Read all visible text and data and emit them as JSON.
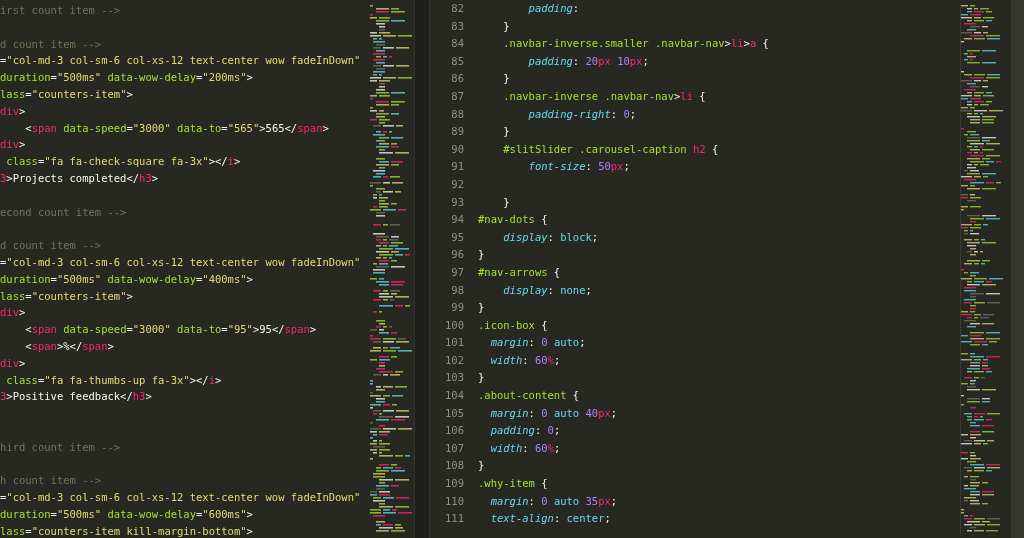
{
  "left_editor": {
    "lines": [
      {
        "kind": "code",
        "tokens": [
          {
            "kind": "comment",
            "text": "irst count item -->"
          }
        ]
      },
      {
        "kind": "blank"
      },
      {
        "kind": "code",
        "tokens": [
          {
            "kind": "comment",
            "text": "d count item -->"
          }
        ]
      },
      {
        "kind": "code",
        "tokens": [
          {
            "kind": "plain",
            "text": "="
          },
          {
            "kind": "string",
            "text": "\"col-md-3 col-sm-6 col-xs-12 text-center wow fadeInDown\""
          }
        ]
      },
      {
        "kind": "code",
        "tokens": [
          {
            "kind": "attr",
            "text": "duration"
          },
          {
            "kind": "plain",
            "text": "="
          },
          {
            "kind": "string",
            "text": "\"500ms\""
          },
          {
            "kind": "attr",
            "text": " data-wow-delay"
          },
          {
            "kind": "plain",
            "text": "="
          },
          {
            "kind": "string",
            "text": "\"200ms\""
          },
          {
            "kind": "plain",
            "text": ">"
          }
        ]
      },
      {
        "kind": "code",
        "tokens": [
          {
            "kind": "attr",
            "text": "lass"
          },
          {
            "kind": "plain",
            "text": "="
          },
          {
            "kind": "string",
            "text": "\"counters-item\""
          },
          {
            "kind": "plain",
            "text": ">"
          }
        ]
      },
      {
        "kind": "code",
        "tokens": [
          {
            "kind": "tag",
            "text": "div"
          },
          {
            "kind": "plain",
            "text": ">"
          }
        ]
      },
      {
        "kind": "code",
        "tokens": [
          {
            "kind": "plain",
            "text": "    <"
          },
          {
            "kind": "tag",
            "text": "span"
          },
          {
            "kind": "attr",
            "text": " data-speed"
          },
          {
            "kind": "plain",
            "text": "="
          },
          {
            "kind": "string",
            "text": "\"3000\""
          },
          {
            "kind": "attr",
            "text": " data-to"
          },
          {
            "kind": "plain",
            "text": "="
          },
          {
            "kind": "string",
            "text": "\"565\""
          },
          {
            "kind": "plain",
            "text": ">565</"
          },
          {
            "kind": "tag",
            "text": "span"
          },
          {
            "kind": "plain",
            "text": ">"
          }
        ]
      },
      {
        "kind": "code",
        "tokens": [
          {
            "kind": "tag",
            "text": "div"
          },
          {
            "kind": "plain",
            "text": ">"
          }
        ]
      },
      {
        "kind": "code",
        "tokens": [
          {
            "kind": "attr",
            "text": " class"
          },
          {
            "kind": "plain",
            "text": "="
          },
          {
            "kind": "string",
            "text": "\"fa fa-check-square fa-3x\""
          },
          {
            "kind": "plain",
            "text": "></"
          },
          {
            "kind": "tag",
            "text": "i"
          },
          {
            "kind": "plain",
            "text": ">"
          }
        ]
      },
      {
        "kind": "code",
        "tokens": [
          {
            "kind": "tag",
            "text": "3"
          },
          {
            "kind": "plain",
            "text": ">Projects completed</"
          },
          {
            "kind": "tag",
            "text": "h3"
          },
          {
            "kind": "plain",
            "text": ">"
          }
        ]
      },
      {
        "kind": "blank"
      },
      {
        "kind": "code",
        "tokens": [
          {
            "kind": "comment",
            "text": "econd count item -->"
          }
        ]
      },
      {
        "kind": "blank"
      },
      {
        "kind": "code",
        "tokens": [
          {
            "kind": "comment",
            "text": "d count item -->"
          }
        ]
      },
      {
        "kind": "code",
        "tokens": [
          {
            "kind": "plain",
            "text": "="
          },
          {
            "kind": "string",
            "text": "\"col-md-3 col-sm-6 col-xs-12 text-center wow fadeInDown\""
          }
        ]
      },
      {
        "kind": "code",
        "tokens": [
          {
            "kind": "attr",
            "text": "duration"
          },
          {
            "kind": "plain",
            "text": "="
          },
          {
            "kind": "string",
            "text": "\"500ms\""
          },
          {
            "kind": "attr",
            "text": " data-wow-delay"
          },
          {
            "kind": "plain",
            "text": "="
          },
          {
            "kind": "string",
            "text": "\"400ms\""
          },
          {
            "kind": "plain",
            "text": ">"
          }
        ]
      },
      {
        "kind": "code",
        "tokens": [
          {
            "kind": "attr",
            "text": "lass"
          },
          {
            "kind": "plain",
            "text": "="
          },
          {
            "kind": "string",
            "text": "\"counters-item\""
          },
          {
            "kind": "plain",
            "text": ">"
          }
        ]
      },
      {
        "kind": "code",
        "tokens": [
          {
            "kind": "tag",
            "text": "div"
          },
          {
            "kind": "plain",
            "text": ">"
          }
        ]
      },
      {
        "kind": "code",
        "tokens": [
          {
            "kind": "plain",
            "text": "    <"
          },
          {
            "kind": "tag",
            "text": "span"
          },
          {
            "kind": "attr",
            "text": " data-speed"
          },
          {
            "kind": "plain",
            "text": "="
          },
          {
            "kind": "string",
            "text": "\"3000\""
          },
          {
            "kind": "attr",
            "text": " data-to"
          },
          {
            "kind": "plain",
            "text": "="
          },
          {
            "kind": "string",
            "text": "\"95\""
          },
          {
            "kind": "plain",
            "text": ">95</"
          },
          {
            "kind": "tag",
            "text": "span"
          },
          {
            "kind": "plain",
            "text": ">"
          }
        ]
      },
      {
        "kind": "code",
        "tokens": [
          {
            "kind": "plain",
            "text": "    <"
          },
          {
            "kind": "tag",
            "text": "span"
          },
          {
            "kind": "plain",
            "text": ">%</"
          },
          {
            "kind": "tag",
            "text": "span"
          },
          {
            "kind": "plain",
            "text": ">"
          }
        ]
      },
      {
        "kind": "code",
        "tokens": [
          {
            "kind": "tag",
            "text": "div"
          },
          {
            "kind": "plain",
            "text": ">"
          }
        ]
      },
      {
        "kind": "code",
        "tokens": [
          {
            "kind": "attr",
            "text": " class"
          },
          {
            "kind": "plain",
            "text": "="
          },
          {
            "kind": "string",
            "text": "\"fa fa-thumbs-up fa-3x\""
          },
          {
            "kind": "plain",
            "text": "></"
          },
          {
            "kind": "tag",
            "text": "i"
          },
          {
            "kind": "plain",
            "text": ">"
          }
        ]
      },
      {
        "kind": "code",
        "tokens": [
          {
            "kind": "tag",
            "text": "3"
          },
          {
            "kind": "plain",
            "text": ">Positive feedback</"
          },
          {
            "kind": "tag",
            "text": "h3"
          },
          {
            "kind": "plain",
            "text": ">"
          }
        ]
      },
      {
        "kind": "blank"
      },
      {
        "kind": "blank"
      },
      {
        "kind": "code",
        "tokens": [
          {
            "kind": "comment",
            "text": "hird count item -->"
          }
        ]
      },
      {
        "kind": "blank"
      },
      {
        "kind": "code",
        "tokens": [
          {
            "kind": "comment",
            "text": "h count item -->"
          }
        ]
      },
      {
        "kind": "code",
        "tokens": [
          {
            "kind": "plain",
            "text": "="
          },
          {
            "kind": "string",
            "text": "\"col-md-3 col-sm-6 col-xs-12 text-center wow fadeInDown\""
          }
        ]
      },
      {
        "kind": "code",
        "tokens": [
          {
            "kind": "attr",
            "text": "duration"
          },
          {
            "kind": "plain",
            "text": "="
          },
          {
            "kind": "string",
            "text": "\"500ms\""
          },
          {
            "kind": "attr",
            "text": " data-wow-delay"
          },
          {
            "kind": "plain",
            "text": "="
          },
          {
            "kind": "string",
            "text": "\"600ms\""
          },
          {
            "kind": "plain",
            "text": ">"
          }
        ]
      },
      {
        "kind": "code",
        "tokens": [
          {
            "kind": "attr",
            "text": "lass"
          },
          {
            "kind": "plain",
            "text": "="
          },
          {
            "kind": "string",
            "text": "\"counters-item kill-margin-bottom\""
          },
          {
            "kind": "plain",
            "text": ">"
          }
        ]
      }
    ]
  },
  "right_editor": {
    "lines": [
      {
        "number": "82",
        "tokens": [
          {
            "kind": "property",
            "text": "        padding"
          },
          {
            "kind": "plain",
            "text": ":"
          }
        ]
      },
      {
        "number": "83",
        "tokens": [
          {
            "kind": "plain",
            "text": "    }"
          }
        ]
      },
      {
        "number": "84",
        "tokens": [
          {
            "kind": "selector",
            "text": "    .navbar-inverse.smaller .navbar-nav"
          },
          {
            "kind": "plain",
            "text": ">"
          },
          {
            "kind": "tag",
            "text": "li"
          },
          {
            "kind": "plain",
            "text": ">"
          },
          {
            "kind": "tag",
            "text": "a"
          },
          {
            "kind": "plain",
            "text": " {"
          }
        ]
      },
      {
        "number": "85",
        "tokens": [
          {
            "kind": "property",
            "text": "        padding"
          },
          {
            "kind": "plain",
            "text": ": "
          },
          {
            "kind": "number",
            "text": "20"
          },
          {
            "kind": "unit",
            "text": "px"
          },
          {
            "kind": "number",
            "text": " 10"
          },
          {
            "kind": "unit",
            "text": "px"
          },
          {
            "kind": "plain",
            "text": ";"
          }
        ]
      },
      {
        "number": "86",
        "tokens": [
          {
            "kind": "plain",
            "text": "    }"
          }
        ]
      },
      {
        "number": "87",
        "tokens": [
          {
            "kind": "selector",
            "text": "    .navbar-inverse .navbar-nav"
          },
          {
            "kind": "plain",
            "text": ">"
          },
          {
            "kind": "tag",
            "text": "li"
          },
          {
            "kind": "plain",
            "text": " {"
          }
        ]
      },
      {
        "number": "88",
        "tokens": [
          {
            "kind": "property",
            "text": "        padding-right"
          },
          {
            "kind": "plain",
            "text": ": "
          },
          {
            "kind": "number",
            "text": "0"
          },
          {
            "kind": "plain",
            "text": ";"
          }
        ]
      },
      {
        "number": "89",
        "tokens": [
          {
            "kind": "plain",
            "text": "    }"
          }
        ]
      },
      {
        "number": "90",
        "tokens": [
          {
            "kind": "selector",
            "text": "    #slitSlider .carousel-caption"
          },
          {
            "kind": "tag",
            "text": " h2"
          },
          {
            "kind": "plain",
            "text": " {"
          }
        ]
      },
      {
        "number": "91",
        "tokens": [
          {
            "kind": "property",
            "text": "        font-size"
          },
          {
            "kind": "plain",
            "text": ": "
          },
          {
            "kind": "number",
            "text": "50"
          },
          {
            "kind": "unit",
            "text": "px"
          },
          {
            "kind": "plain",
            "text": ";"
          }
        ]
      },
      {
        "number": "92"
      },
      {
        "number": "93",
        "tokens": [
          {
            "kind": "plain",
            "text": "    }"
          }
        ]
      },
      {
        "number": "94",
        "tokens": [
          {
            "kind": "selector",
            "text": "#nav-dots"
          },
          {
            "kind": "plain",
            "text": " {"
          }
        ]
      },
      {
        "number": "95",
        "tokens": [
          {
            "kind": "property",
            "text": "    display"
          },
          {
            "kind": "plain",
            "text": ": "
          },
          {
            "kind": "value",
            "text": "block"
          },
          {
            "kind": "plain",
            "text": ";"
          }
        ]
      },
      {
        "number": "96",
        "tokens": [
          {
            "kind": "plain",
            "text": "}"
          }
        ]
      },
      {
        "number": "97",
        "tokens": [
          {
            "kind": "selector",
            "text": "#nav-arrows"
          },
          {
            "kind": "plain",
            "text": " {"
          }
        ]
      },
      {
        "number": "98",
        "tokens": [
          {
            "kind": "property",
            "text": "    display"
          },
          {
            "kind": "plain",
            "text": ": "
          },
          {
            "kind": "value",
            "text": "none"
          },
          {
            "kind": "plain",
            "text": ";"
          }
        ]
      },
      {
        "number": "99",
        "tokens": [
          {
            "kind": "plain",
            "text": "}"
          }
        ]
      },
      {
        "number": "100",
        "tokens": [
          {
            "kind": "selector",
            "text": ".icon-box"
          },
          {
            "kind": "plain",
            "text": " {"
          }
        ]
      },
      {
        "number": "101",
        "tokens": [
          {
            "kind": "property",
            "text": "  margin"
          },
          {
            "kind": "plain",
            "text": ": "
          },
          {
            "kind": "number",
            "text": "0"
          },
          {
            "kind": "value",
            "text": " auto"
          },
          {
            "kind": "plain",
            "text": ";"
          }
        ]
      },
      {
        "number": "102",
        "tokens": [
          {
            "kind": "property",
            "text": "  width"
          },
          {
            "kind": "plain",
            "text": ": "
          },
          {
            "kind": "number",
            "text": "60"
          },
          {
            "kind": "unit",
            "text": "%"
          },
          {
            "kind": "plain",
            "text": ";"
          }
        ]
      },
      {
        "number": "103",
        "tokens": [
          {
            "kind": "plain",
            "text": "}"
          }
        ]
      },
      {
        "number": "104",
        "tokens": [
          {
            "kind": "selector",
            "text": ".about-content"
          },
          {
            "kind": "plain",
            "text": " {"
          }
        ]
      },
      {
        "number": "105",
        "tokens": [
          {
            "kind": "property",
            "text": "  margin"
          },
          {
            "kind": "plain",
            "text": ": "
          },
          {
            "kind": "number",
            "text": "0"
          },
          {
            "kind": "value",
            "text": " auto"
          },
          {
            "kind": "number",
            "text": " 40"
          },
          {
            "kind": "unit",
            "text": "px"
          },
          {
            "kind": "plain",
            "text": ";"
          }
        ]
      },
      {
        "number": "106",
        "tokens": [
          {
            "kind": "property",
            "text": "  padding"
          },
          {
            "kind": "plain",
            "text": ": "
          },
          {
            "kind": "number",
            "text": "0"
          },
          {
            "kind": "plain",
            "text": ";"
          }
        ]
      },
      {
        "number": "107",
        "tokens": [
          {
            "kind": "property",
            "text": "  width"
          },
          {
            "kind": "plain",
            "text": ": "
          },
          {
            "kind": "number",
            "text": "60"
          },
          {
            "kind": "unit",
            "text": "%"
          },
          {
            "kind": "plain",
            "text": ";"
          }
        ]
      },
      {
        "number": "108",
        "tokens": [
          {
            "kind": "plain",
            "text": "}"
          }
        ]
      },
      {
        "number": "109",
        "tokens": [
          {
            "kind": "selector",
            "text": ".why-item"
          },
          {
            "kind": "plain",
            "text": " {"
          }
        ]
      },
      {
        "number": "110",
        "tokens": [
          {
            "kind": "property",
            "text": "  margin"
          },
          {
            "kind": "plain",
            "text": ": "
          },
          {
            "kind": "number",
            "text": "0"
          },
          {
            "kind": "value",
            "text": " auto"
          },
          {
            "kind": "number",
            "text": " 35"
          },
          {
            "kind": "unit",
            "text": "px"
          },
          {
            "kind": "plain",
            "text": ";"
          }
        ]
      },
      {
        "number": "111",
        "tokens": [
          {
            "kind": "property",
            "text": "  text-align"
          },
          {
            "kind": "plain",
            "text": ": "
          },
          {
            "kind": "value",
            "text": "center"
          },
          {
            "kind": "plain",
            "text": ";"
          }
        ]
      }
    ]
  }
}
